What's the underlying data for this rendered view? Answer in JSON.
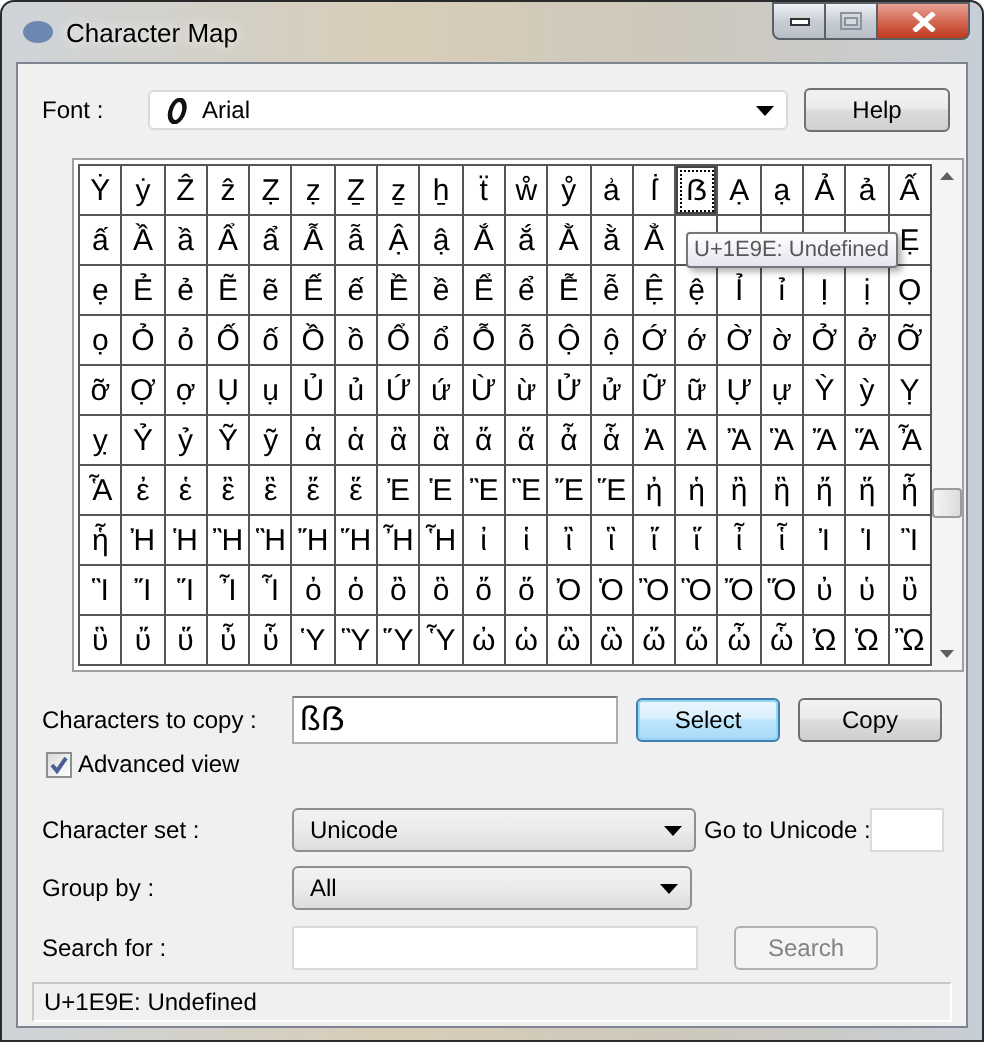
{
  "window": {
    "title": "Character Map"
  },
  "font": {
    "label": "Font :",
    "value": "Arial",
    "help_button": "Help"
  },
  "grid": {
    "rows": [
      [
        {
          "char": "Ẏ",
          "selected": false
        },
        {
          "char": "ẏ",
          "selected": false
        },
        {
          "char": "Ẑ",
          "selected": false
        },
        {
          "char": "ẑ",
          "selected": false
        },
        {
          "char": "Ẓ",
          "selected": false
        },
        {
          "char": "ẓ",
          "selected": false
        },
        {
          "char": "Ẕ",
          "selected": false
        },
        {
          "char": "ẕ",
          "selected": false
        },
        {
          "char": "ẖ",
          "selected": false
        },
        {
          "char": "ẗ",
          "selected": false
        },
        {
          "char": "ẘ",
          "selected": false
        },
        {
          "char": "ẙ",
          "selected": false
        },
        {
          "char": "ẚ",
          "selected": false
        },
        {
          "char": "ẛ",
          "selected": false
        },
        {
          "char": "ẞ",
          "selected": true
        },
        {
          "char": "Ạ",
          "selected": false
        },
        {
          "char": "ạ",
          "selected": false
        },
        {
          "char": "Ả",
          "selected": false
        },
        {
          "char": "ả",
          "selected": false
        },
        {
          "char": "Ấ",
          "selected": false
        }
      ],
      [
        {
          "char": "ấ",
          "selected": false
        },
        {
          "char": "Ầ",
          "selected": false
        },
        {
          "char": "ầ",
          "selected": false
        },
        {
          "char": "Ẩ",
          "selected": false
        },
        {
          "char": "ẩ",
          "selected": false
        },
        {
          "char": "Ẫ",
          "selected": false
        },
        {
          "char": "ẫ",
          "selected": false
        },
        {
          "char": "Ậ",
          "selected": false
        },
        {
          "char": "ậ",
          "selected": false
        },
        {
          "char": "Ắ",
          "selected": false
        },
        {
          "char": "ắ",
          "selected": false
        },
        {
          "char": "Ằ",
          "selected": false
        },
        {
          "char": "ằ",
          "selected": false
        },
        {
          "char": "Ẳ",
          "selected": false
        },
        {
          "selected": false
        },
        {
          "selected": false
        },
        {
          "selected": false
        },
        {
          "selected": false
        },
        {
          "selected": false
        },
        {
          "char": "Ẹ",
          "selected": false
        }
      ],
      [
        {
          "char": "ẹ",
          "selected": false
        },
        {
          "char": "Ẻ",
          "selected": false
        },
        {
          "char": "ẻ",
          "selected": false
        },
        {
          "char": "Ẽ",
          "selected": false
        },
        {
          "char": "ẽ",
          "selected": false
        },
        {
          "char": "Ế",
          "selected": false
        },
        {
          "char": "ế",
          "selected": false
        },
        {
          "char": "Ề",
          "selected": false
        },
        {
          "char": "ề",
          "selected": false
        },
        {
          "char": "Ể",
          "selected": false
        },
        {
          "char": "ể",
          "selected": false
        },
        {
          "char": "Ễ",
          "selected": false
        },
        {
          "char": "ễ",
          "selected": false
        },
        {
          "char": "Ệ",
          "selected": false
        },
        {
          "char": "ệ",
          "selected": false
        },
        {
          "char": "Ỉ",
          "selected": false
        },
        {
          "char": "ỉ",
          "selected": false
        },
        {
          "char": "Ị",
          "selected": false
        },
        {
          "char": "ị",
          "selected": false
        },
        {
          "char": "Ọ",
          "selected": false
        }
      ],
      [
        {
          "char": "ọ",
          "selected": false
        },
        {
          "char": "Ỏ",
          "selected": false
        },
        {
          "char": "ỏ",
          "selected": false
        },
        {
          "char": "Ố",
          "selected": false
        },
        {
          "char": "ố",
          "selected": false
        },
        {
          "char": "Ồ",
          "selected": false
        },
        {
          "char": "ồ",
          "selected": false
        },
        {
          "char": "Ổ",
          "selected": false
        },
        {
          "char": "ổ",
          "selected": false
        },
        {
          "char": "Ỗ",
          "selected": false
        },
        {
          "char": "ỗ",
          "selected": false
        },
        {
          "char": "Ộ",
          "selected": false
        },
        {
          "char": "ộ",
          "selected": false
        },
        {
          "char": "Ớ",
          "selected": false
        },
        {
          "char": "ớ",
          "selected": false
        },
        {
          "char": "Ờ",
          "selected": false
        },
        {
          "char": "ờ",
          "selected": false
        },
        {
          "char": "Ở",
          "selected": false
        },
        {
          "char": "ở",
          "selected": false
        },
        {
          "char": "Ỡ",
          "selected": false
        }
      ],
      [
        {
          "char": "ỡ",
          "selected": false
        },
        {
          "char": "Ợ",
          "selected": false
        },
        {
          "char": "ợ",
          "selected": false
        },
        {
          "char": "Ụ",
          "selected": false
        },
        {
          "char": "ụ",
          "selected": false
        },
        {
          "char": "Ủ",
          "selected": false
        },
        {
          "char": "ủ",
          "selected": false
        },
        {
          "char": "Ứ",
          "selected": false
        },
        {
          "char": "ứ",
          "selected": false
        },
        {
          "char": "Ừ",
          "selected": false
        },
        {
          "char": "ừ",
          "selected": false
        },
        {
          "char": "Ử",
          "selected": false
        },
        {
          "char": "ử",
          "selected": false
        },
        {
          "char": "Ữ",
          "selected": false
        },
        {
          "char": "ữ",
          "selected": false
        },
        {
          "char": "Ự",
          "selected": false
        },
        {
          "char": "ự",
          "selected": false
        },
        {
          "char": "Ỳ",
          "selected": false
        },
        {
          "char": "ỳ",
          "selected": false
        },
        {
          "char": "Ỵ",
          "selected": false
        }
      ],
      [
        {
          "char": "ỵ",
          "selected": false
        },
        {
          "char": "Ỷ",
          "selected": false
        },
        {
          "char": "ỷ",
          "selected": false
        },
        {
          "char": "Ỹ",
          "selected": false
        },
        {
          "char": "ỹ",
          "selected": false
        },
        {
          "char": "ἀ",
          "selected": false
        },
        {
          "char": "ἁ",
          "selected": false
        },
        {
          "char": "ἂ",
          "selected": false
        },
        {
          "char": "ἃ",
          "selected": false
        },
        {
          "char": "ἄ",
          "selected": false
        },
        {
          "char": "ἅ",
          "selected": false
        },
        {
          "char": "ἆ",
          "selected": false
        },
        {
          "char": "ἇ",
          "selected": false
        },
        {
          "char": "Ἀ",
          "selected": false
        },
        {
          "char": "Ἁ",
          "selected": false
        },
        {
          "char": "Ἂ",
          "selected": false
        },
        {
          "char": "Ἃ",
          "selected": false
        },
        {
          "char": "Ἄ",
          "selected": false
        },
        {
          "char": "Ἅ",
          "selected": false
        },
        {
          "char": "Ἆ",
          "selected": false
        }
      ],
      [
        {
          "char": "Ἇ",
          "selected": false
        },
        {
          "char": "ἐ",
          "selected": false
        },
        {
          "char": "ἑ",
          "selected": false
        },
        {
          "char": "ἒ",
          "selected": false
        },
        {
          "char": "ἓ",
          "selected": false
        },
        {
          "char": "ἔ",
          "selected": false
        },
        {
          "char": "ἕ",
          "selected": false
        },
        {
          "char": "Ἐ",
          "selected": false
        },
        {
          "char": "Ἑ",
          "selected": false
        },
        {
          "char": "Ἒ",
          "selected": false
        },
        {
          "char": "Ἓ",
          "selected": false
        },
        {
          "char": "Ἔ",
          "selected": false
        },
        {
          "char": "Ἕ",
          "selected": false
        },
        {
          "char": "ἠ",
          "selected": false
        },
        {
          "char": "ἡ",
          "selected": false
        },
        {
          "char": "ἢ",
          "selected": false
        },
        {
          "char": "ἣ",
          "selected": false
        },
        {
          "char": "ἤ",
          "selected": false
        },
        {
          "char": "ἥ",
          "selected": false
        },
        {
          "char": "ἦ",
          "selected": false
        }
      ],
      [
        {
          "char": "ἧ",
          "selected": false
        },
        {
          "char": "Ἠ",
          "selected": false
        },
        {
          "char": "Ἡ",
          "selected": false
        },
        {
          "char": "Ἢ",
          "selected": false
        },
        {
          "char": "Ἣ",
          "selected": false
        },
        {
          "char": "Ἤ",
          "selected": false
        },
        {
          "char": "Ἥ",
          "selected": false
        },
        {
          "char": "Ἦ",
          "selected": false
        },
        {
          "char": "Ἧ",
          "selected": false
        },
        {
          "char": "ἰ",
          "selected": false
        },
        {
          "char": "ἱ",
          "selected": false
        },
        {
          "char": "ἲ",
          "selected": false
        },
        {
          "char": "ἳ",
          "selected": false
        },
        {
          "char": "ἴ",
          "selected": false
        },
        {
          "char": "ἵ",
          "selected": false
        },
        {
          "char": "ἶ",
          "selected": false
        },
        {
          "char": "ἷ",
          "selected": false
        },
        {
          "char": "Ἰ",
          "selected": false
        },
        {
          "char": "Ἱ",
          "selected": false
        },
        {
          "char": "Ἲ",
          "selected": false
        }
      ],
      [
        {
          "char": "Ἳ",
          "selected": false
        },
        {
          "char": "Ἴ",
          "selected": false
        },
        {
          "char": "Ἵ",
          "selected": false
        },
        {
          "char": "Ἶ",
          "selected": false
        },
        {
          "char": "Ἷ",
          "selected": false
        },
        {
          "char": "ὀ",
          "selected": false
        },
        {
          "char": "ὁ",
          "selected": false
        },
        {
          "char": "ὂ",
          "selected": false
        },
        {
          "char": "ὃ",
          "selected": false
        },
        {
          "char": "ὄ",
          "selected": false
        },
        {
          "char": "ὅ",
          "selected": false
        },
        {
          "char": "Ὀ",
          "selected": false
        },
        {
          "char": "Ὁ",
          "selected": false
        },
        {
          "char": "Ὂ",
          "selected": false
        },
        {
          "char": "Ὃ",
          "selected": false
        },
        {
          "char": "Ὄ",
          "selected": false
        },
        {
          "char": "Ὅ",
          "selected": false
        },
        {
          "char": "ὐ",
          "selected": false
        },
        {
          "char": "ὑ",
          "selected": false
        },
        {
          "char": "ὒ",
          "selected": false
        }
      ],
      [
        {
          "char": "ὓ",
          "selected": false
        },
        {
          "char": "ὔ",
          "selected": false
        },
        {
          "char": "ὕ",
          "selected": false
        },
        {
          "char": "ὖ",
          "selected": false
        },
        {
          "char": "ὗ",
          "selected": false
        },
        {
          "char": "Ὑ",
          "selected": false
        },
        {
          "char": "Ὓ",
          "selected": false
        },
        {
          "char": "Ὕ",
          "selected": false
        },
        {
          "char": "Ὗ",
          "selected": false
        },
        {
          "char": "ὠ",
          "selected": false
        },
        {
          "char": "ὡ",
          "selected": false
        },
        {
          "char": "ὢ",
          "selected": false
        },
        {
          "char": "ὣ",
          "selected": false
        },
        {
          "char": "ὤ",
          "selected": false
        },
        {
          "char": "ὥ",
          "selected": false
        },
        {
          "char": "ὦ",
          "selected": false
        },
        {
          "char": "ὧ",
          "selected": false
        },
        {
          "char": "Ὠ",
          "selected": false
        },
        {
          "char": "Ὡ",
          "selected": false
        },
        {
          "char": "Ὢ",
          "selected": false
        }
      ]
    ],
    "tooltip": "U+1E9E: Undefined"
  },
  "copy": {
    "label": "Characters to copy :",
    "value": "ßẞ",
    "select_button": "Select",
    "select_highlighted": true,
    "copy_button": "Copy"
  },
  "advanced_view": {
    "label": "Advanced view",
    "checked": true
  },
  "character_set": {
    "label": "Character set :",
    "value": "Unicode"
  },
  "go_to_unicode": {
    "label": "Go to Unicode :"
  },
  "group_by": {
    "label": "Group by :",
    "value": "All"
  },
  "search": {
    "label": "Search for :",
    "button": "Search",
    "button_disabled": true
  },
  "status_bar": "U+1E9E: Undefined"
}
